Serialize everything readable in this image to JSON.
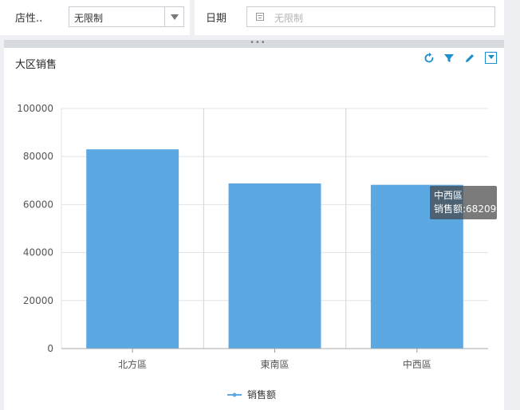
{
  "filters": {
    "store_type": {
      "label": "店性..",
      "value": "无限制"
    },
    "date": {
      "label": "日期",
      "placeholder": "无限制"
    }
  },
  "widget": {
    "title": "大区销售",
    "tools": [
      "refresh-icon",
      "filter-icon",
      "edit-icon",
      "dropdown-menu-icon"
    ]
  },
  "colors": {
    "bar": "#5ca8e2",
    "accent": "#1e8ecc",
    "grid": "#e3e3e3"
  },
  "chart_data": {
    "type": "bar",
    "categories": [
      "北方區",
      "東南區",
      "中西區"
    ],
    "series": [
      {
        "name": "销售额",
        "values": [
          83000,
          68800,
          68209
        ]
      }
    ],
    "ylim": [
      0,
      100000
    ],
    "yticks": [
      0,
      20000,
      40000,
      60000,
      80000,
      100000
    ],
    "grid": true,
    "legend": "bottom-center"
  },
  "tooltip": {
    "category": "中西區",
    "text": "销售额:68209"
  }
}
